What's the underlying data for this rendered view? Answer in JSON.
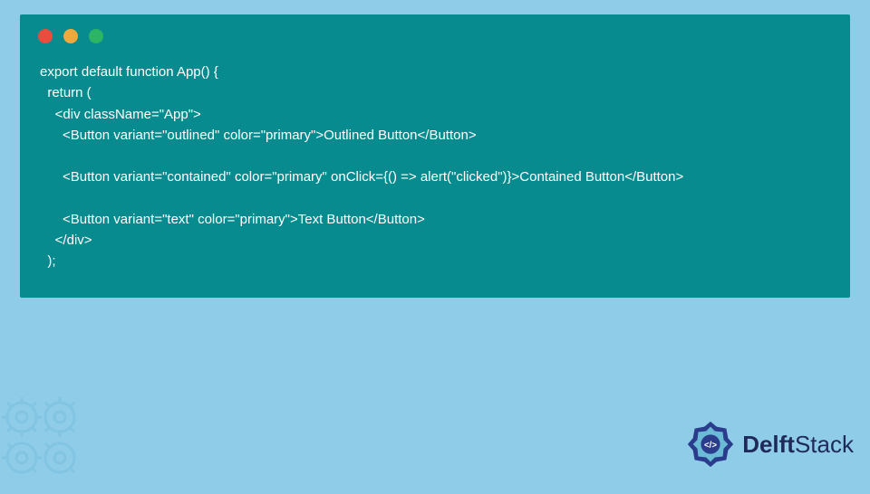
{
  "code": {
    "lines": [
      "export default function App() {",
      "  return (",
      "    <div className=\"App\">",
      "      <Button variant=\"outlined\" color=\"primary\">Outlined Button</Button>",
      "",
      "      <Button variant=\"contained\" color=\"primary\" onClick={() => alert(\"clicked\")}>Contained Button</Button>",
      "",
      "      <Button variant=\"text\" color=\"primary\">Text Button</Button>",
      "    </div>",
      "  );"
    ]
  },
  "branding": {
    "name_part1": "Delft",
    "name_part2": "Stack"
  },
  "colors": {
    "page_bg": "#8FCCE8",
    "window_bg": "#078B8F",
    "code_text": "#FFFFFF",
    "logo_text": "#1F2A5A",
    "logo_accent": "#2B3C8C"
  }
}
